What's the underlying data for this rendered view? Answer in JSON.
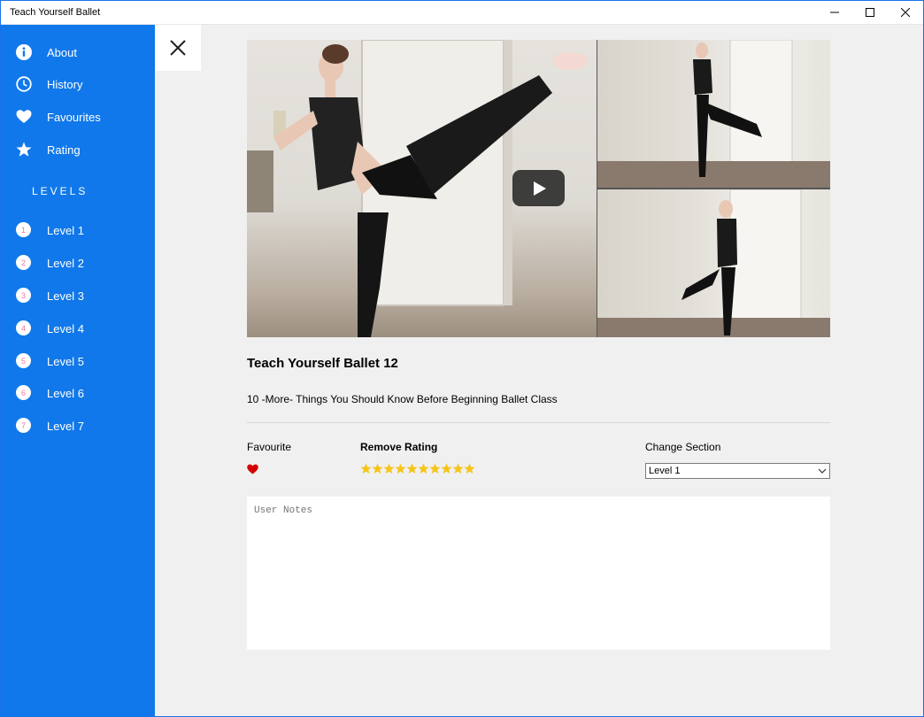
{
  "window": {
    "title": "Teach Yourself Ballet"
  },
  "sidebar": {
    "items": [
      {
        "label": "About",
        "icon": "info-icon"
      },
      {
        "label": "History",
        "icon": "clock-icon"
      },
      {
        "label": "Favourites",
        "icon": "heart-icon"
      },
      {
        "label": "Rating",
        "icon": "star-icon"
      }
    ],
    "levels_heading": "LEVELS",
    "levels": [
      {
        "num": "1",
        "label": "Level 1"
      },
      {
        "num": "2",
        "label": "Level 2"
      },
      {
        "num": "3",
        "label": "Level 3"
      },
      {
        "num": "4",
        "label": "Level 4"
      },
      {
        "num": "5",
        "label": "Level 5"
      },
      {
        "num": "6",
        "label": "Level 6"
      },
      {
        "num": "7",
        "label": "Level 7"
      }
    ]
  },
  "video": {
    "title": "Teach Yourself Ballet 12",
    "description": "10 -More- Things You Should Know Before Beginning Ballet Class"
  },
  "controls": {
    "favourite_label": "Favourite",
    "rating_label": "Remove Rating",
    "rating_stars": 10,
    "section_label": "Change Section",
    "section_selected": "Level 1"
  },
  "notes": {
    "placeholder": "User Notes"
  },
  "colors": {
    "sidebar": "#1078ea",
    "star": "#f5c518",
    "heart": "#d40000",
    "level_number": "#f07aa0"
  }
}
